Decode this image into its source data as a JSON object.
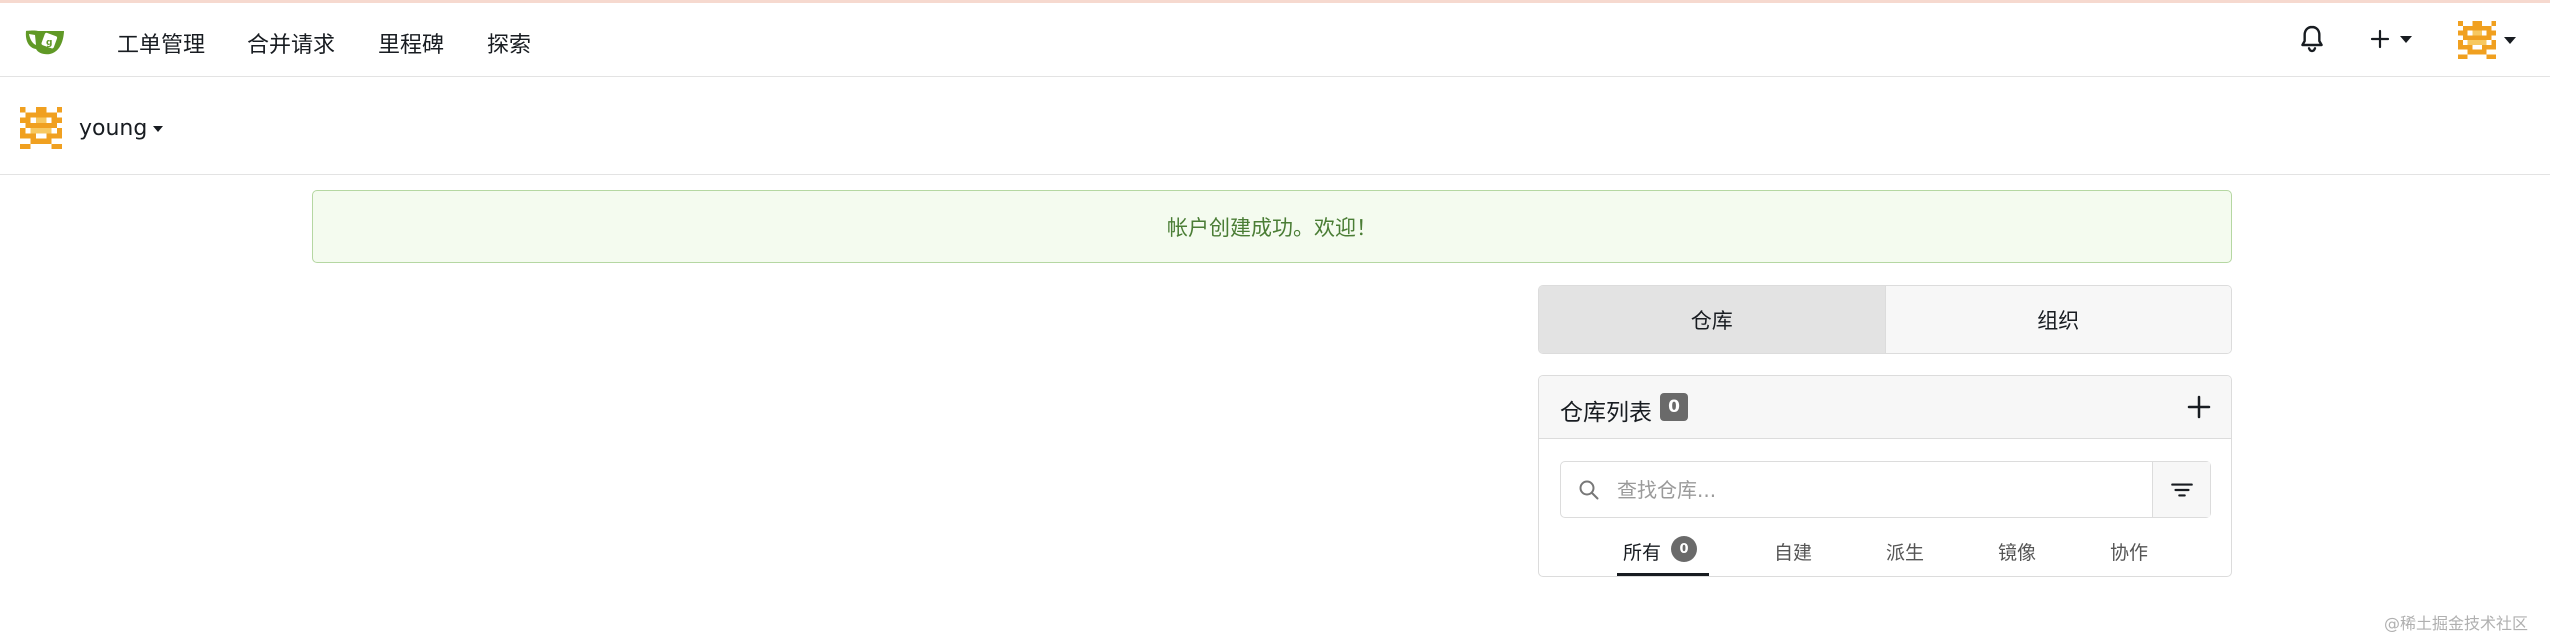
{
  "navbar": {
    "items": [
      "工单管理",
      "合并请求",
      "里程碑",
      "探索"
    ]
  },
  "context": {
    "username": "young"
  },
  "flash": {
    "message": "帐户创建成功。欢迎！"
  },
  "segment": {
    "repos_label": "仓库",
    "orgs_label": "组织"
  },
  "repo_list": {
    "title": "仓库列表",
    "count": "0",
    "search_placeholder": "查找仓库...",
    "tabs": [
      {
        "label": "所有",
        "badge": "0"
      },
      {
        "label": "自建"
      },
      {
        "label": "派生"
      },
      {
        "label": "镜像"
      },
      {
        "label": "协作"
      }
    ]
  },
  "watermark": "@稀土掘金技术社区",
  "colors": {
    "brand_green": "#609926",
    "flash_text": "#4a7d35",
    "avatar_orange": "#f0a020"
  }
}
